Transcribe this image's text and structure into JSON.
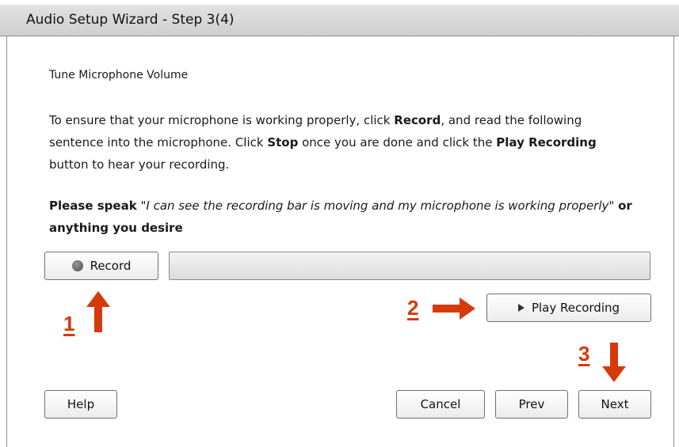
{
  "window": {
    "title": "Audio Setup Wizard - Step 3(4)"
  },
  "main": {
    "heading": "Tune Microphone Volume",
    "instruction": {
      "p1": "To ensure that your microphone is working properly, click ",
      "b1": "Record",
      "p2": ", and read the following sentence into the microphone. Click ",
      "b2": "Stop",
      "p3": " once you are done and click the ",
      "b3": "Play Recording",
      "p4": " button to hear your recording."
    },
    "speak": {
      "label": "Please speak",
      "quote": "\"I can see the recording bar is moving and my microphone is working properly\"",
      "suffix": "or anything you desire"
    }
  },
  "controls": {
    "record_label": "Record",
    "recording_level": 0,
    "play_label": "Play Recording"
  },
  "annotations": {
    "step1": "1",
    "step2": "2",
    "step3": "3",
    "color": "#d63a0a"
  },
  "footer": {
    "help_label": "Help",
    "cancel_label": "Cancel",
    "prev_label": "Prev",
    "next_label": "Next"
  }
}
